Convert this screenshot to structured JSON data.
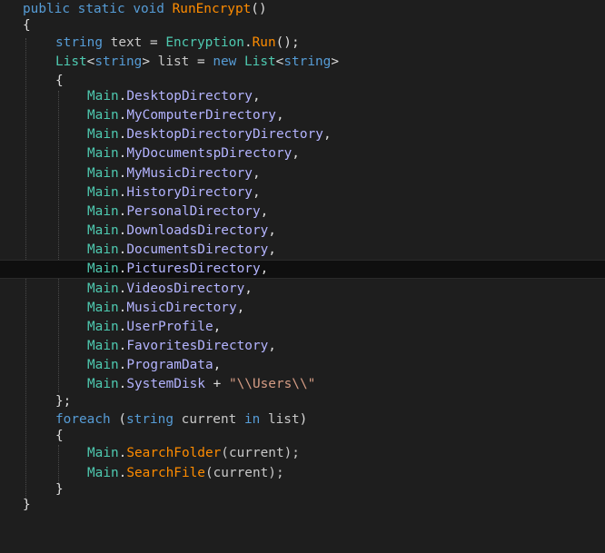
{
  "editor": {
    "colors": {
      "background": "#1e1e1e",
      "keyword": "#569cd6",
      "type": "#4ec9b0",
      "method": "#ff8c00",
      "property": "#b4b4ff",
      "string": "#d69d85",
      "punctuation": "#dcdcdc"
    },
    "tokens": {
      "public": "public",
      "static": "static",
      "void": "void",
      "method_name": "RunEncrypt",
      "parens_empty": "()",
      "brace_open": "{",
      "brace_close": "}",
      "brace_close_semi": "};",
      "string_kw": "string",
      "text_var": "text",
      "eq": "=",
      "encryption": "Encryption",
      "dot": ".",
      "run": "Run",
      "call_end": "();",
      "list_type": "List",
      "lt": "<",
      "gt": ">",
      "list_var": "list",
      "new_kw": "new",
      "main": "Main",
      "comma": ",",
      "plus": "+",
      "users_str": "\"\\\\Users\\\\\"",
      "foreach_kw": "foreach",
      "lparen": "(",
      "rparen": ")",
      "current_var": "current",
      "in_kw": "in",
      "search_folder": "SearchFolder",
      "search_file": "SearchFile",
      "arg_current": "(current);"
    },
    "directories": [
      "DesktopDirectory",
      "MyComputerDirectory",
      "DesktopDirectoryDirectory",
      "MyDocumentspDirectory",
      "MyMusicDirectory",
      "HistoryDirectory",
      "PersonalDirectory",
      "DownloadsDirectory",
      "DocumentsDirectory",
      "PicturesDirectory",
      "VideosDirectory",
      "MusicDirectory",
      "UserProfile",
      "FavoritesDirectory",
      "ProgramData"
    ],
    "last_directory": "SystemDisk"
  }
}
